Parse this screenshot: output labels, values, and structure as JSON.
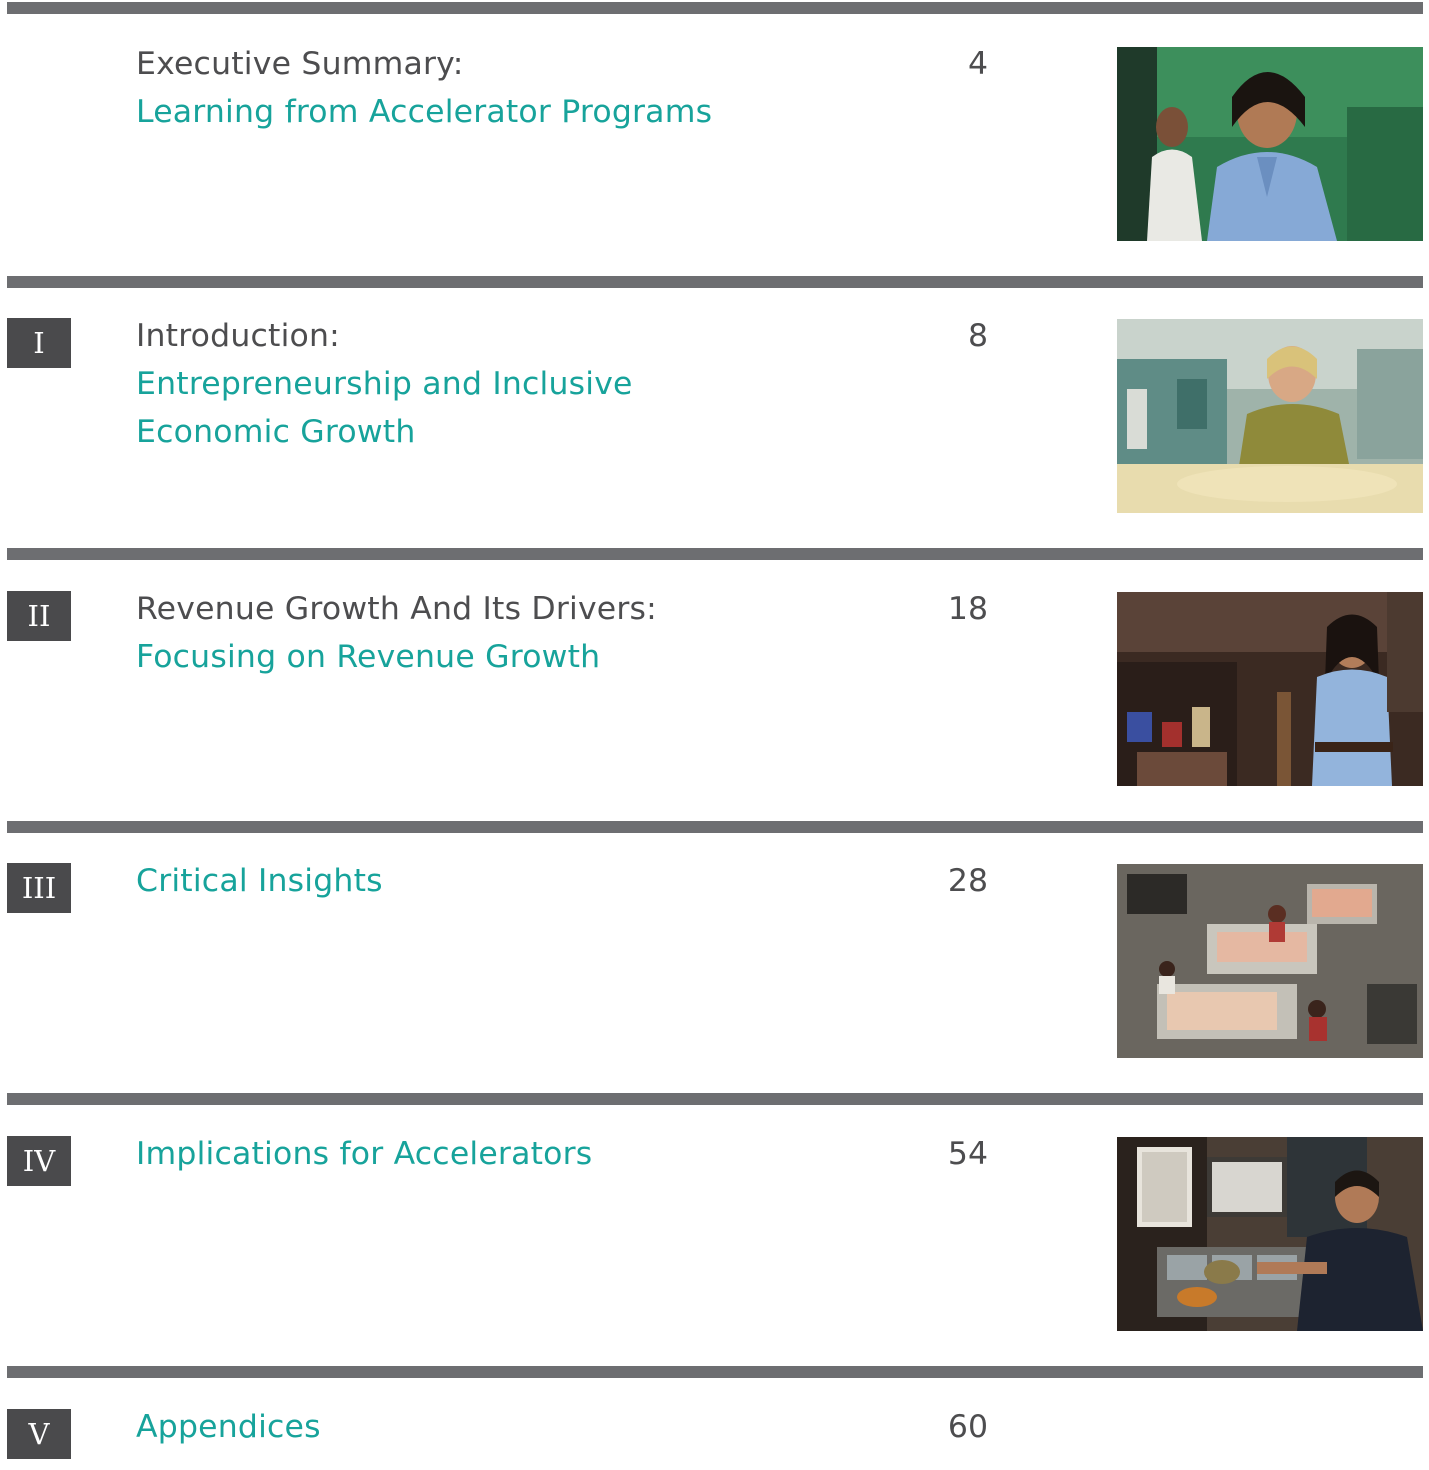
{
  "sections": [
    {
      "numeral": "",
      "label": "Executive Summary:",
      "subtitle_lines": [
        "Learning from Accelerator Programs"
      ],
      "page": "4",
      "image": "woman-in-blue-shirt-photo"
    },
    {
      "numeral": "I",
      "label": "Introduction:",
      "subtitle_lines": [
        "Entrepreneurship and Inclusive",
        "Economic Growth"
      ],
      "page": "8",
      "image": "woman-working-in-workshop-photo"
    },
    {
      "numeral": "II",
      "label": "Revenue Growth And Its Drivers:",
      "subtitle_lines": [
        "Focusing on Revenue Growth"
      ],
      "page": "18",
      "image": "woman-in-shop-photo"
    },
    {
      "numeral": "III",
      "label": "",
      "subtitle_lines": [
        "Critical Insights"
      ],
      "page": "28",
      "image": "bakery-overhead-photo"
    },
    {
      "numeral": "IV",
      "label": "",
      "subtitle_lines": [
        "Implications for Accelerators"
      ],
      "page": "54",
      "image": "man-in-kitchen-photo"
    },
    {
      "numeral": "V",
      "label": "",
      "subtitle_lines": [
        "Appendices"
      ],
      "page": "60",
      "image": ""
    }
  ],
  "colors": {
    "divider": "#6d6e71",
    "numeral_box": "#4a4a4c",
    "label_text": "#4d4d4f",
    "accent_teal": "#17a39b"
  }
}
